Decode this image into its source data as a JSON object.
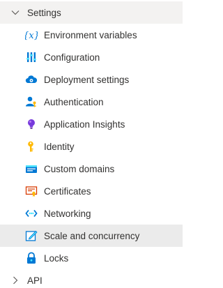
{
  "groups": {
    "settings": {
      "label": "Settings",
      "expanded": true,
      "items": [
        {
          "label": "Environment variables",
          "icon": "variable-icon"
        },
        {
          "label": "Configuration",
          "icon": "configuration-sliders-icon"
        },
        {
          "label": "Deployment settings",
          "icon": "cloud-gear-icon"
        },
        {
          "label": "Authentication",
          "icon": "user-key-icon"
        },
        {
          "label": "Application Insights",
          "icon": "lightbulb-icon"
        },
        {
          "label": "Identity",
          "icon": "key-identity-icon"
        },
        {
          "label": "Custom domains",
          "icon": "domain-card-icon"
        },
        {
          "label": "Certificates",
          "icon": "certificate-icon"
        },
        {
          "label": "Networking",
          "icon": "networking-icon"
        },
        {
          "label": "Scale and concurrency",
          "icon": "scale-edit-icon",
          "selected": true
        },
        {
          "label": "Locks",
          "icon": "lock-icon"
        }
      ]
    },
    "api": {
      "label": "API",
      "expanded": false
    }
  },
  "colors": {
    "selected_background": "#ebebeb",
    "header_background": "#f3f2f1",
    "text": "#323130",
    "azure_blue": "#0078d4"
  }
}
